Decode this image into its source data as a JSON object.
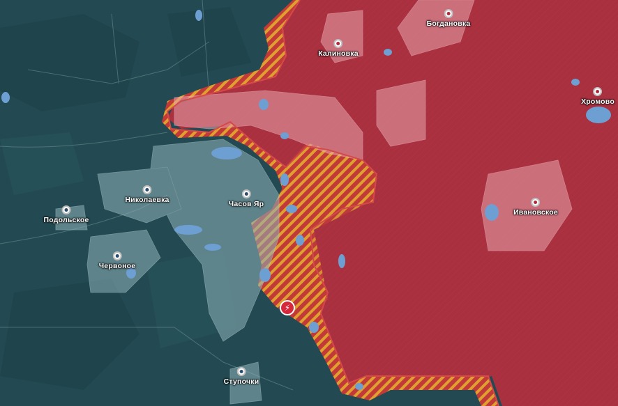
{
  "map": {
    "colors": {
      "ukraine_control": "#2a5861",
      "russia_control": "#a9303f",
      "contested_stripe_a": "#e0a030",
      "contested_stripe_b": "#c23a38",
      "settlement_ua": "#8fb2b8",
      "settlement_ru": "#e7a3ad",
      "water": "#6e9fd2"
    },
    "places": [
      {
        "name": "Богдановка",
        "side": "russia"
      },
      {
        "name": "Калиновка",
        "side": "russia"
      },
      {
        "name": "Хромово",
        "side": "russia"
      },
      {
        "name": "Николаевка",
        "side": "ukraine"
      },
      {
        "name": "Часов Яр",
        "side": "ukraine"
      },
      {
        "name": "Подольское",
        "side": "ukraine"
      },
      {
        "name": "Ивановское",
        "side": "russia"
      },
      {
        "name": "Червоное",
        "side": "ukraine"
      },
      {
        "name": "Ступочки",
        "side": "ukraine"
      }
    ],
    "event_icon": "lightning-icon"
  }
}
